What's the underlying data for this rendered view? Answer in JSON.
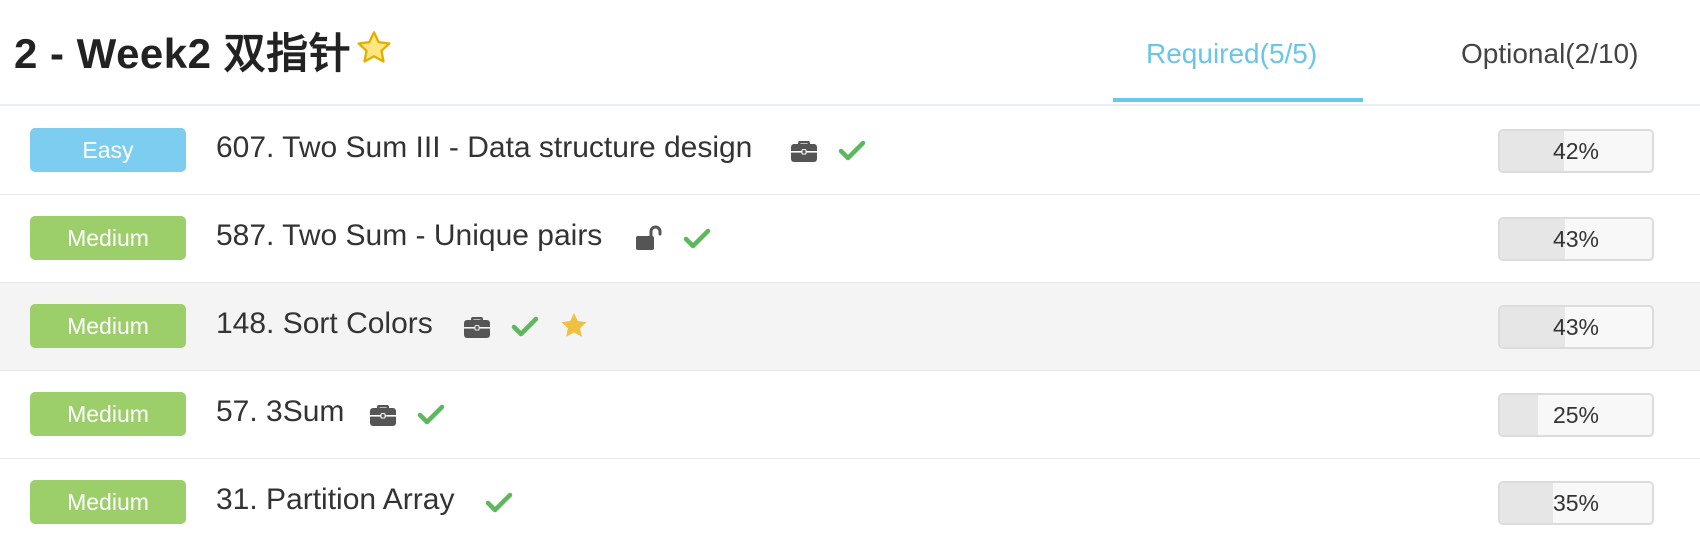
{
  "header": {
    "title": "2 - Week2 双指针",
    "tabs": [
      {
        "label": "Required(5/5)",
        "active": true
      },
      {
        "label": "Optional(2/10)",
        "active": false
      }
    ]
  },
  "colors": {
    "accent": "#6ac6e8",
    "easy": "#7ccdf0",
    "medium": "#9ccf6a",
    "check": "#5cb85c",
    "star": "#f0c040"
  },
  "problems": [
    {
      "difficulty": "Easy",
      "title": "607. Two Sum III - Data structure design",
      "icons": [
        "briefcase-icon",
        "check-icon"
      ],
      "progress_label": "42%",
      "progress": 0.42
    },
    {
      "difficulty": "Medium",
      "title": "587. Two Sum - Unique pairs",
      "icons": [
        "unlock-icon",
        "check-icon"
      ],
      "progress_label": "43%",
      "progress": 0.43
    },
    {
      "difficulty": "Medium",
      "title": "148. Sort Colors",
      "icons": [
        "briefcase-icon",
        "check-icon",
        "star-icon"
      ],
      "progress_label": "43%",
      "progress": 0.43,
      "highlighted": true
    },
    {
      "difficulty": "Medium",
      "title": "57. 3Sum",
      "icons": [
        "briefcase-icon",
        "check-icon"
      ],
      "progress_label": "25%",
      "progress": 0.25
    },
    {
      "difficulty": "Medium",
      "title": "31. Partition Array",
      "icons": [
        "check-icon"
      ],
      "progress_label": "35%",
      "progress": 0.35
    }
  ]
}
